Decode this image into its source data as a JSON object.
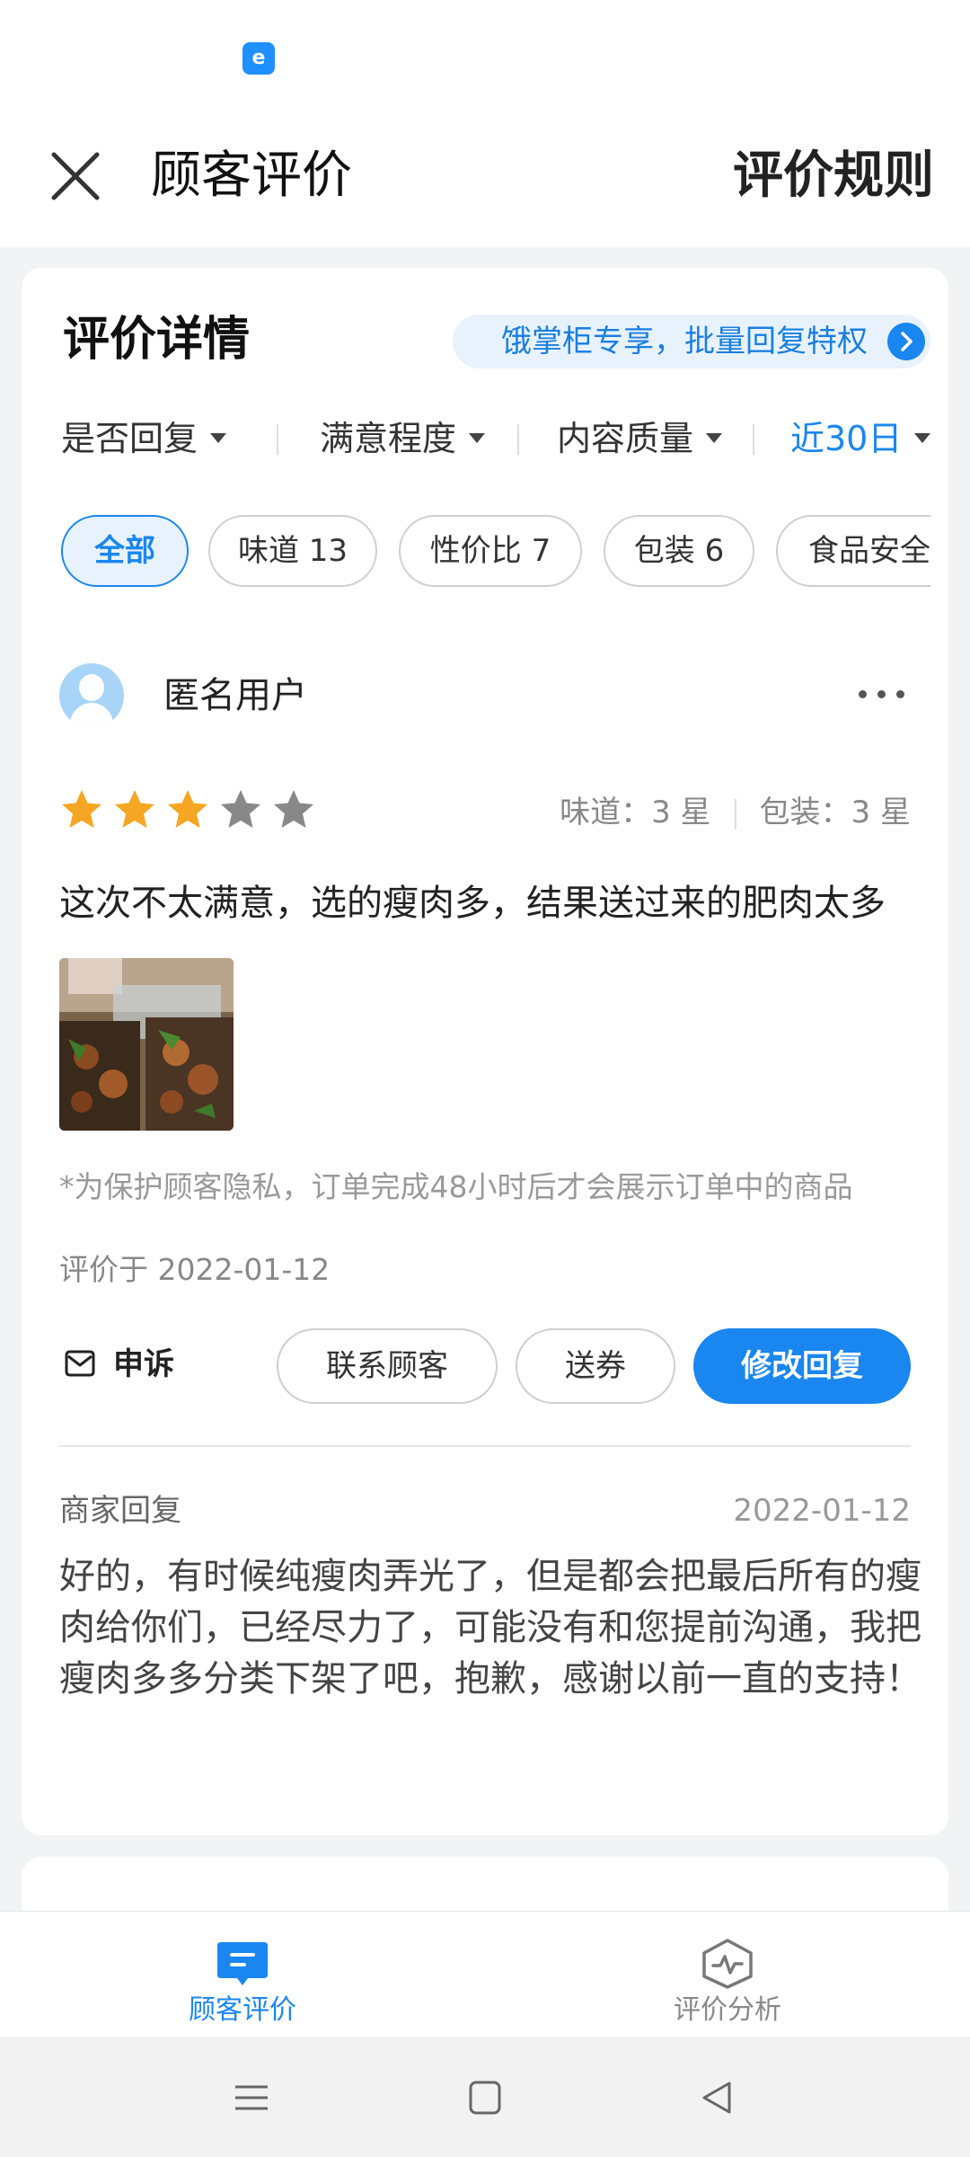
{
  "colors": {
    "accent": "#1a86f0",
    "star_on": "#f5a623",
    "star_off": "#888888"
  },
  "header": {
    "title": "顾客评价",
    "rules_link": "评价规则",
    "close_icon": "close-icon"
  },
  "section": {
    "title": "评价详情",
    "promo": "饿掌柜专享，批量回复特权"
  },
  "filters": [
    {
      "label": "是否回复"
    },
    {
      "label": "满意程度"
    },
    {
      "label": "内容质量"
    },
    {
      "label": "近30日"
    }
  ],
  "chips": [
    {
      "label": "全部"
    },
    {
      "label": "味道 13"
    },
    {
      "label": "性价比 7"
    },
    {
      "label": "包装 6"
    },
    {
      "label": "食品安全"
    }
  ],
  "review": {
    "user": "匿名用户",
    "rating": 3,
    "max_rating": 5,
    "taste_score": "味道：3 星",
    "package_score": "包装：3 星",
    "text": "这次不太满意，选的瘦肉多，结果送过来的肥肉太多",
    "privacy_note": "*为保护顾客隐私，订单完成48小时后才会展示订单中的商品",
    "date": "评价于 2022-01-12",
    "actions": {
      "appeal": "申诉",
      "contact": "联系顾客",
      "coupon": "送券",
      "edit_reply": "修改回复"
    }
  },
  "reply": {
    "label": "商家回复",
    "date": "2022-01-12",
    "text": "好的，有时候纯瘦肉弄光了，但是都会把最后所有的瘦肉给你们，已经尽力了，可能没有和您提前沟通，我把瘦肉多多分类下架了吧，抱歉，感谢以前一直的支持！"
  },
  "tabs": [
    {
      "label": "顾客评价",
      "icon": "message-icon",
      "active": true
    },
    {
      "label": "评价分析",
      "icon": "analysis-icon",
      "active": false
    }
  ]
}
